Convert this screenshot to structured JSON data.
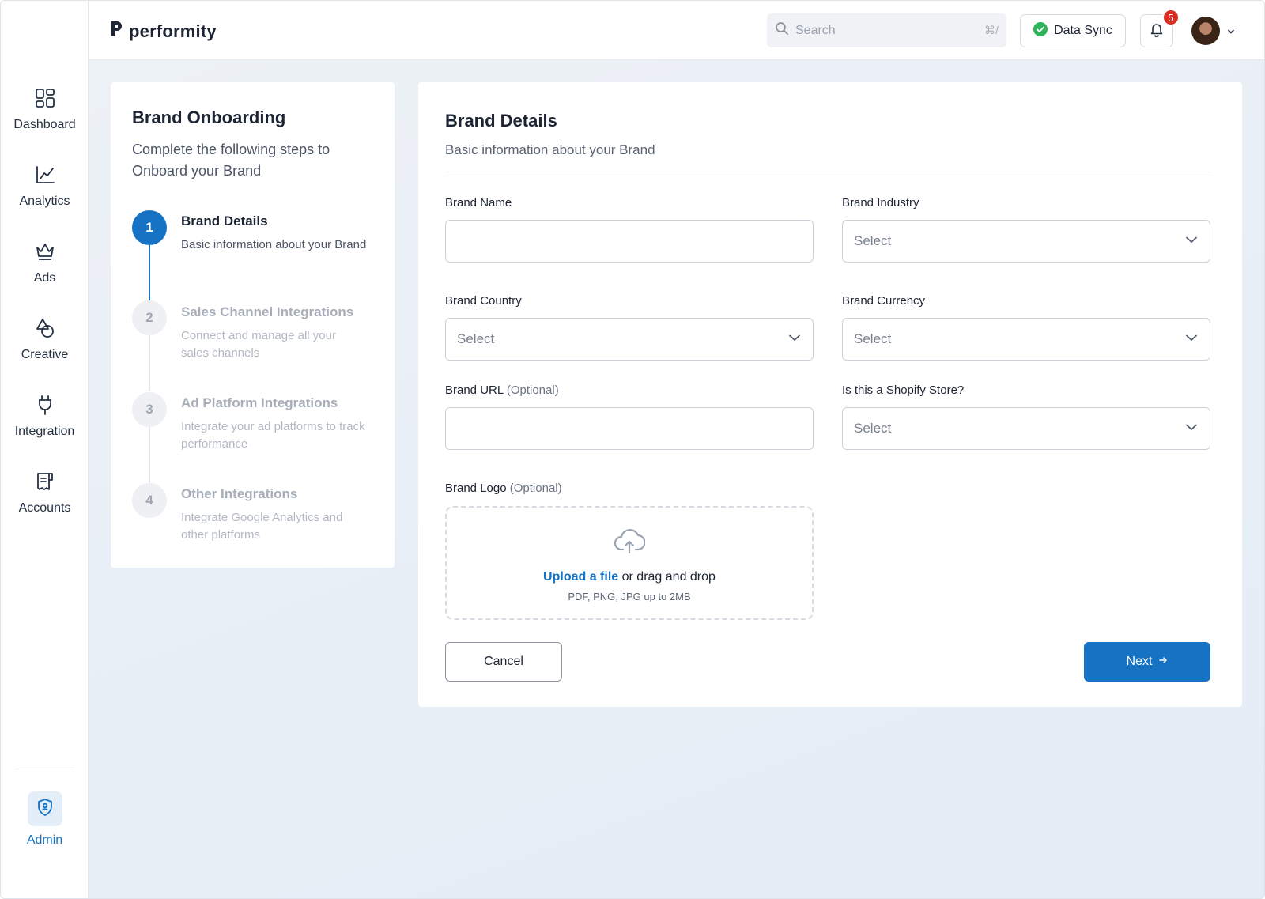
{
  "app": {
    "name": "performity"
  },
  "sidebar": {
    "items": [
      {
        "label": "Dashboard",
        "icon": "dashboard-icon"
      },
      {
        "label": "Analytics",
        "icon": "analytics-icon"
      },
      {
        "label": "Ads",
        "icon": "crown-icon"
      },
      {
        "label": "Creative",
        "icon": "shapes-icon"
      },
      {
        "label": "Integration",
        "icon": "plug-icon"
      },
      {
        "label": "Accounts",
        "icon": "accounts-icon"
      }
    ],
    "admin": {
      "label": "Admin",
      "icon": "shield-user-icon"
    }
  },
  "header": {
    "search": {
      "placeholder": "Search",
      "shortcut": "⌘/"
    },
    "data_sync": {
      "label": "Data Sync",
      "status_color": "#2db35a"
    },
    "notifications": {
      "count": "5"
    }
  },
  "onboarding": {
    "title": "Brand Onboarding",
    "subtitle": "Complete the following steps to Onboard your Brand",
    "steps": [
      {
        "number": "1",
        "name": "Brand Details",
        "description": "Basic information about your Brand",
        "state": "active"
      },
      {
        "number": "2",
        "name": "Sales Channel Integrations",
        "description": "Connect and manage all your sales channels",
        "state": "inactive"
      },
      {
        "number": "3",
        "name": "Ad Platform Integrations",
        "description": "Integrate your ad platforms to track performance",
        "state": "inactive"
      },
      {
        "number": "4",
        "name": "Other Integrations",
        "description": "Integrate Google Analytics and other platforms",
        "state": "inactive"
      }
    ]
  },
  "form": {
    "title": "Brand Details",
    "subtitle": "Basic information about your Brand",
    "fields": {
      "brand_name": {
        "label": "Brand Name",
        "value": "",
        "placeholder": ""
      },
      "brand_industry": {
        "label": "Brand Industry",
        "value": "Select"
      },
      "brand_country": {
        "label": "Brand Country",
        "value": "Select"
      },
      "brand_currency": {
        "label": "Brand Currency",
        "value": "Select"
      },
      "brand_url": {
        "label": "Brand URL",
        "optional": "(Optional)",
        "value": "",
        "placeholder": ""
      },
      "shopify_store": {
        "label": "Is this a Shopify Store?",
        "value": "Select"
      },
      "brand_logo": {
        "label": "Brand Logo",
        "optional": "(Optional)",
        "upload_link": "Upload a file",
        "upload_rest": "or drag and drop",
        "hint": "PDF, PNG, JPG up to 2MB"
      }
    },
    "cancel_label": "Cancel",
    "next_label": "Next"
  },
  "colors": {
    "accent": "#1672c2",
    "badge": "#d92d20"
  }
}
